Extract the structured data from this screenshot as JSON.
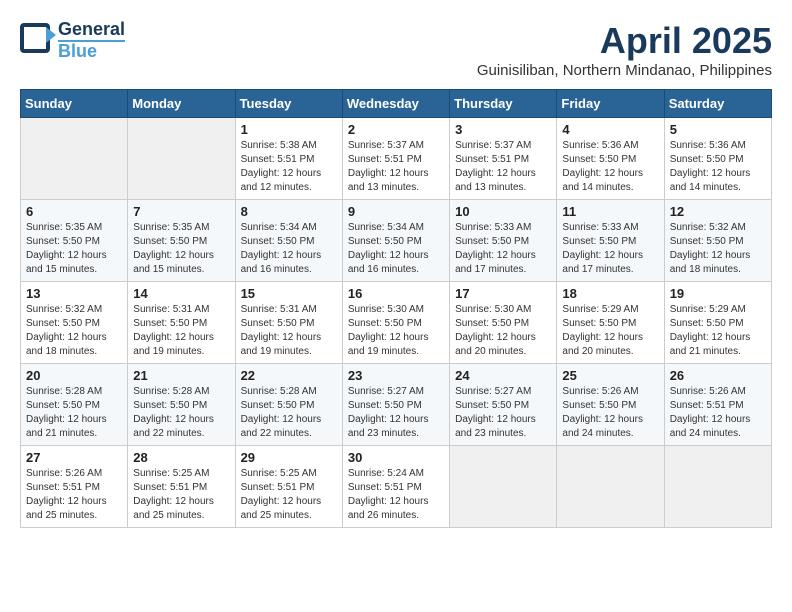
{
  "header": {
    "logo_general": "General",
    "logo_blue": "Blue",
    "month_title": "April 2025",
    "subtitle": "Guinisiliban, Northern Mindanao, Philippines"
  },
  "weekdays": [
    "Sunday",
    "Monday",
    "Tuesday",
    "Wednesday",
    "Thursday",
    "Friday",
    "Saturday"
  ],
  "weeks": [
    [
      {
        "day": "",
        "sunrise": "",
        "sunset": "",
        "daylight": ""
      },
      {
        "day": "",
        "sunrise": "",
        "sunset": "",
        "daylight": ""
      },
      {
        "day": "1",
        "sunrise": "Sunrise: 5:38 AM",
        "sunset": "Sunset: 5:51 PM",
        "daylight": "Daylight: 12 hours and 12 minutes."
      },
      {
        "day": "2",
        "sunrise": "Sunrise: 5:37 AM",
        "sunset": "Sunset: 5:51 PM",
        "daylight": "Daylight: 12 hours and 13 minutes."
      },
      {
        "day": "3",
        "sunrise": "Sunrise: 5:37 AM",
        "sunset": "Sunset: 5:51 PM",
        "daylight": "Daylight: 12 hours and 13 minutes."
      },
      {
        "day": "4",
        "sunrise": "Sunrise: 5:36 AM",
        "sunset": "Sunset: 5:50 PM",
        "daylight": "Daylight: 12 hours and 14 minutes."
      },
      {
        "day": "5",
        "sunrise": "Sunrise: 5:36 AM",
        "sunset": "Sunset: 5:50 PM",
        "daylight": "Daylight: 12 hours and 14 minutes."
      }
    ],
    [
      {
        "day": "6",
        "sunrise": "Sunrise: 5:35 AM",
        "sunset": "Sunset: 5:50 PM",
        "daylight": "Daylight: 12 hours and 15 minutes."
      },
      {
        "day": "7",
        "sunrise": "Sunrise: 5:35 AM",
        "sunset": "Sunset: 5:50 PM",
        "daylight": "Daylight: 12 hours and 15 minutes."
      },
      {
        "day": "8",
        "sunrise": "Sunrise: 5:34 AM",
        "sunset": "Sunset: 5:50 PM",
        "daylight": "Daylight: 12 hours and 16 minutes."
      },
      {
        "day": "9",
        "sunrise": "Sunrise: 5:34 AM",
        "sunset": "Sunset: 5:50 PM",
        "daylight": "Daylight: 12 hours and 16 minutes."
      },
      {
        "day": "10",
        "sunrise": "Sunrise: 5:33 AM",
        "sunset": "Sunset: 5:50 PM",
        "daylight": "Daylight: 12 hours and 17 minutes."
      },
      {
        "day": "11",
        "sunrise": "Sunrise: 5:33 AM",
        "sunset": "Sunset: 5:50 PM",
        "daylight": "Daylight: 12 hours and 17 minutes."
      },
      {
        "day": "12",
        "sunrise": "Sunrise: 5:32 AM",
        "sunset": "Sunset: 5:50 PM",
        "daylight": "Daylight: 12 hours and 18 minutes."
      }
    ],
    [
      {
        "day": "13",
        "sunrise": "Sunrise: 5:32 AM",
        "sunset": "Sunset: 5:50 PM",
        "daylight": "Daylight: 12 hours and 18 minutes."
      },
      {
        "day": "14",
        "sunrise": "Sunrise: 5:31 AM",
        "sunset": "Sunset: 5:50 PM",
        "daylight": "Daylight: 12 hours and 19 minutes."
      },
      {
        "day": "15",
        "sunrise": "Sunrise: 5:31 AM",
        "sunset": "Sunset: 5:50 PM",
        "daylight": "Daylight: 12 hours and 19 minutes."
      },
      {
        "day": "16",
        "sunrise": "Sunrise: 5:30 AM",
        "sunset": "Sunset: 5:50 PM",
        "daylight": "Daylight: 12 hours and 19 minutes."
      },
      {
        "day": "17",
        "sunrise": "Sunrise: 5:30 AM",
        "sunset": "Sunset: 5:50 PM",
        "daylight": "Daylight: 12 hours and 20 minutes."
      },
      {
        "day": "18",
        "sunrise": "Sunrise: 5:29 AM",
        "sunset": "Sunset: 5:50 PM",
        "daylight": "Daylight: 12 hours and 20 minutes."
      },
      {
        "day": "19",
        "sunrise": "Sunrise: 5:29 AM",
        "sunset": "Sunset: 5:50 PM",
        "daylight": "Daylight: 12 hours and 21 minutes."
      }
    ],
    [
      {
        "day": "20",
        "sunrise": "Sunrise: 5:28 AM",
        "sunset": "Sunset: 5:50 PM",
        "daylight": "Daylight: 12 hours and 21 minutes."
      },
      {
        "day": "21",
        "sunrise": "Sunrise: 5:28 AM",
        "sunset": "Sunset: 5:50 PM",
        "daylight": "Daylight: 12 hours and 22 minutes."
      },
      {
        "day": "22",
        "sunrise": "Sunrise: 5:28 AM",
        "sunset": "Sunset: 5:50 PM",
        "daylight": "Daylight: 12 hours and 22 minutes."
      },
      {
        "day": "23",
        "sunrise": "Sunrise: 5:27 AM",
        "sunset": "Sunset: 5:50 PM",
        "daylight": "Daylight: 12 hours and 23 minutes."
      },
      {
        "day": "24",
        "sunrise": "Sunrise: 5:27 AM",
        "sunset": "Sunset: 5:50 PM",
        "daylight": "Daylight: 12 hours and 23 minutes."
      },
      {
        "day": "25",
        "sunrise": "Sunrise: 5:26 AM",
        "sunset": "Sunset: 5:50 PM",
        "daylight": "Daylight: 12 hours and 24 minutes."
      },
      {
        "day": "26",
        "sunrise": "Sunrise: 5:26 AM",
        "sunset": "Sunset: 5:51 PM",
        "daylight": "Daylight: 12 hours and 24 minutes."
      }
    ],
    [
      {
        "day": "27",
        "sunrise": "Sunrise: 5:26 AM",
        "sunset": "Sunset: 5:51 PM",
        "daylight": "Daylight: 12 hours and 25 minutes."
      },
      {
        "day": "28",
        "sunrise": "Sunrise: 5:25 AM",
        "sunset": "Sunset: 5:51 PM",
        "daylight": "Daylight: 12 hours and 25 minutes."
      },
      {
        "day": "29",
        "sunrise": "Sunrise: 5:25 AM",
        "sunset": "Sunset: 5:51 PM",
        "daylight": "Daylight: 12 hours and 25 minutes."
      },
      {
        "day": "30",
        "sunrise": "Sunrise: 5:24 AM",
        "sunset": "Sunset: 5:51 PM",
        "daylight": "Daylight: 12 hours and 26 minutes."
      },
      {
        "day": "",
        "sunrise": "",
        "sunset": "",
        "daylight": ""
      },
      {
        "day": "",
        "sunrise": "",
        "sunset": "",
        "daylight": ""
      },
      {
        "day": "",
        "sunrise": "",
        "sunset": "",
        "daylight": ""
      }
    ]
  ]
}
